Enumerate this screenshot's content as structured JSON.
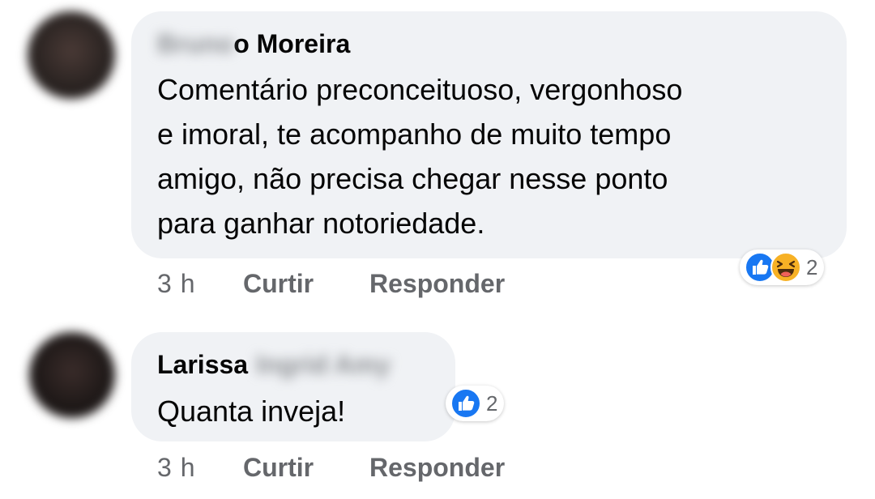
{
  "comments": [
    {
      "author_visible": "o Moreira",
      "author_obscured": "Bruno",
      "text_lines": [
        "Comentário preconceituoso, vergonhoso",
        "e imoral, te acompanho de muito tempo",
        "amigo, não precisa chegar nesse ponto",
        "para ganhar notoriedade."
      ],
      "reaction_icons": [
        "like-icon",
        "haha-icon"
      ],
      "reaction_count": "2",
      "time": "3 h",
      "like_label": "Curtir",
      "reply_label": "Responder"
    },
    {
      "author_visible": "Larissa",
      "author_obscured": "Ingrid Amy",
      "text": "Quanta inveja!",
      "reaction_icons": [
        "like-icon"
      ],
      "reaction_count": "2",
      "time": "3 h",
      "like_label": "Curtir",
      "reply_label": "Responder"
    }
  ],
  "colors": {
    "bubble": "#f0f2f5",
    "meta_text": "#65676b",
    "like_blue": "#1877f2",
    "haha_yellow": "#f7b125"
  }
}
